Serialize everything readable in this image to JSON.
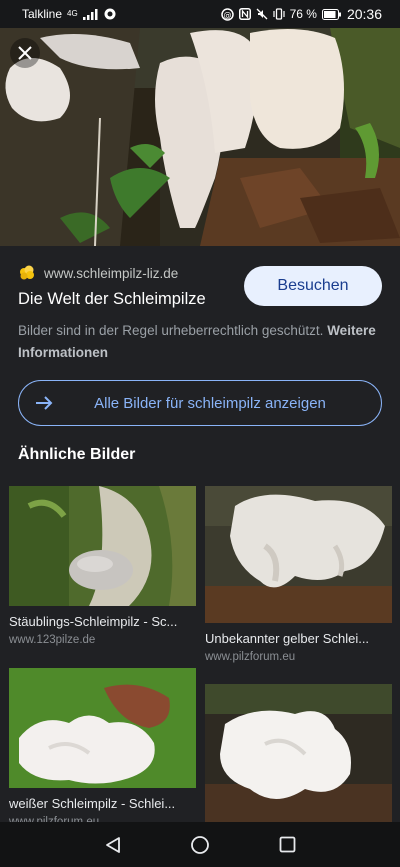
{
  "status_bar": {
    "carrier": "Talkline",
    "network": "4G",
    "battery": "76 %",
    "time": "20:36"
  },
  "detail": {
    "close_icon": "close-icon",
    "source_domain": "www.schleimpilz-liz.de",
    "title": "Die Welt der Schleimpilze",
    "visit_label": "Besuchen",
    "copyright_text": "Bilder sind in der Regel urheberrechtlich geschützt.",
    "more_info_label": "Weitere Informationen",
    "all_images_label": "Alle Bilder für schleimpilz anzeigen"
  },
  "similar": {
    "heading": "Ähnliche Bilder",
    "items": [
      {
        "title": "Stäublings-Schleimpilz - Sc...",
        "source": "www.123pilze.de"
      },
      {
        "title": "Unbekannter gelber Schlei...",
        "source": "www.pilzforum.eu"
      },
      {
        "title": "weißer Schleimpilz - Schlei...",
        "source": "www.pilzforum.eu"
      },
      {
        "title": "",
        "source": ""
      }
    ]
  },
  "nav": {
    "back_icon": "back-icon",
    "home_icon": "home-icon",
    "recents_icon": "recents-icon"
  },
  "colors": {
    "background": "#202124",
    "accent": "#8ab4f8",
    "visit_button_bg": "#e8f0fe",
    "visit_button_text": "#1a3d8f"
  }
}
